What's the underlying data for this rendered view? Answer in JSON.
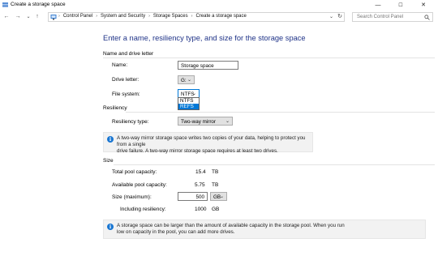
{
  "window": {
    "title": "Create a storage space",
    "minimize": "—",
    "maximize": "☐",
    "close": "✕"
  },
  "nav": {
    "back": "←",
    "forward": "→",
    "recent": "⌄",
    "up": "↑"
  },
  "address": {
    "crumbs": [
      "Control Panel",
      "System and Security",
      "Storage Spaces",
      "Create a storage space"
    ],
    "separator": "›",
    "dropdown": "⌄",
    "refresh": "↻"
  },
  "search": {
    "placeholder": "Search Control Panel"
  },
  "heading": "Enter a name, resiliency type, and size for the storage space",
  "name_section": {
    "title": "Name and drive letter",
    "name_label": "Name:",
    "name_value": "Storage space",
    "drive_label": "Drive letter:",
    "drive_value": "G:",
    "fs_label": "File system:",
    "fs_value": "NTFS",
    "fs_options": [
      "NTFS",
      "REFS"
    ],
    "fs_highlighted": "REFS"
  },
  "resiliency": {
    "title": "Resiliency",
    "type_label": "Resiliency type:",
    "type_value": "Two-way mirror",
    "info": "A two-way mirror storage space writes two copies of your data, helping to protect you from a single drive failure. A two-way mirror storage space requires at least two drives.",
    "info_line1": "A two-way mirror storage space writes two copies of your data, helping to protect you from a single",
    "info_line2": "drive failure. A two-way mirror storage space requires at least two drives."
  },
  "size": {
    "title": "Size",
    "total_label": "Total pool capacity:",
    "total_value": "15.4",
    "total_unit": "TB",
    "avail_label": "Available pool capacity:",
    "avail_value": "5.75",
    "avail_unit": "TB",
    "max_label": "Size (maximum):",
    "max_value": "500",
    "max_unit": "GB",
    "incl_label": "Including resiliency:",
    "incl_value": "1000",
    "incl_unit": "GB",
    "info_line1": "A storage space can be larger than the amount of available capacity in the storage pool. When you run",
    "info_line2": "low on capacity in the pool, you can add more drives."
  },
  "icons": {
    "app": "storage-spaces-icon",
    "info": "i"
  },
  "colors": {
    "heading": "#1e3287",
    "selection": "#0078d7",
    "info_icon": "#1976d2"
  }
}
